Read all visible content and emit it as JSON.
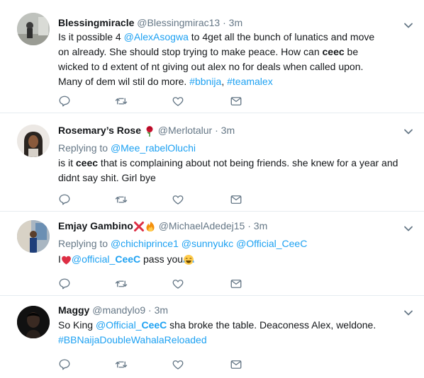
{
  "tweets": [
    {
      "name": "Blessingmiracle",
      "handle": "@Blessingmirac13",
      "time": "3m",
      "body": {
        "t1": "Is it possible 4 ",
        "m1": "@AlexAsogwa",
        "t2": " to 4get all the bunch of lunatics and move on already. She should stop trying to make peace. How can ",
        "b1": "ceec",
        "t3": " be wicked to d extent of nt giving out alex no for deals when called upon. Many of dem wil stil do more. ",
        "h1": "#bbnija",
        "t4": ", ",
        "h2": "#teamalex"
      }
    },
    {
      "name": "Rosemary’s Rose",
      "handle": "@Merlotalur",
      "time": "3m",
      "replying_label": "Replying to",
      "replying_to": "@Mee_rabelOluchi",
      "body": {
        "t1": "is it ",
        "b1": "ceec",
        "t2": " that is complaining about not being friends. she knew for a year and didnt say shit. Girl bye"
      }
    },
    {
      "name": "Emjay Gambino",
      "handle": "@MichaelAdedej15",
      "time": "3m",
      "replying_label": "Replying to",
      "replying_to": [
        "@chichiprince1",
        "@sunnyukc",
        "@Official_CeeC"
      ],
      "body": {
        "t1": "I",
        "m1": "@official_",
        "b1": "CeeC",
        "t2": " pass you"
      }
    },
    {
      "name": "Maggy",
      "handle": "@mandylo9",
      "time": "3m",
      "body": {
        "t1": "So King ",
        "m1": "@Official_",
        "b1": "CeeC",
        "t2": " sha broke the table. Deaconess Alex, weldone.",
        "h1": "#BBNaijaDoubleWahalaReloaded"
      }
    }
  ],
  "dot": "·",
  "icons": [
    "reply-icon",
    "retweet-icon",
    "like-icon",
    "dm-icon",
    "chevron-down-icon",
    "rose-emoji",
    "cross-mark-emoji",
    "fire-emoji",
    "red-heart-emoji",
    "tears-of-joy-emoji"
  ],
  "colors": {
    "link": "#1da1f2",
    "secondary": "#657786",
    "text": "#14171a",
    "divider": "#e6ecf0"
  }
}
